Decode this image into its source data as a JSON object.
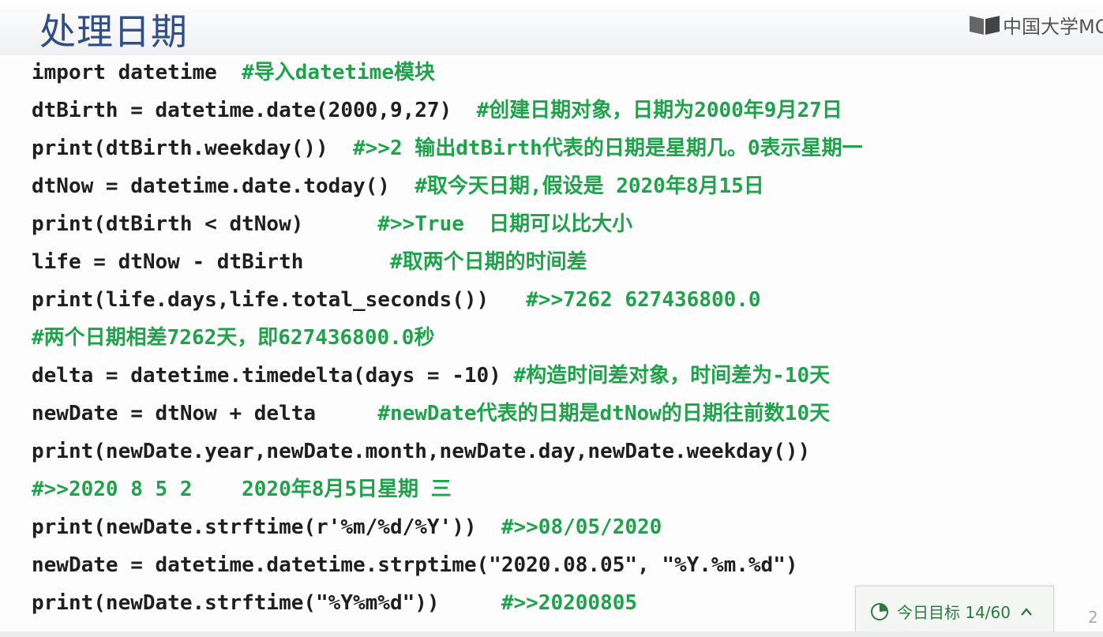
{
  "slide": {
    "title": "处理日期",
    "brand": "中国大学MO",
    "page_number": "2"
  },
  "code_lines": [
    {
      "code": "import datetime  ",
      "comment": "#导入datetime模块"
    },
    {
      "code": "dtBirth = datetime.date(2000,9,27)  ",
      "comment": "#创建日期对象，日期为2000年9月27日"
    },
    {
      "code": "print(dtBirth.weekday())  ",
      "comment": "#>>2 输出dtBirth代表的日期是星期几。0表示星期一"
    },
    {
      "code": "dtNow = datetime.date.today()  ",
      "comment": "#取今天日期,假设是 2020年8月15日"
    },
    {
      "code": "print(dtBirth < dtNow)      ",
      "comment": "#>>True  日期可以比大小"
    },
    {
      "code": "life = dtNow - dtBirth       ",
      "comment": "#取两个日期的时间差"
    },
    {
      "code": "print(life.days,life.total_seconds())   ",
      "comment": "#>>7262 627436800.0"
    },
    {
      "code": "",
      "comment": "#两个日期相差7262天，即627436800.0秒"
    },
    {
      "code": "delta = datetime.timedelta(days = -10) ",
      "comment": "#构造时间差对象，时间差为-10天"
    },
    {
      "code": "newDate = dtNow + delta     ",
      "comment": "#newDate代表的日期是dtNow的日期往前数10天"
    },
    {
      "code": "print(newDate.year,newDate.month,newDate.day,newDate.weekday())",
      "comment": ""
    },
    {
      "code": "",
      "comment": "#>>2020 8 5 2    2020年8月5日星期 三"
    },
    {
      "code": "print(newDate.strftime(r'%m/%d/%Y'))  ",
      "comment": "#>>08/05/2020"
    },
    {
      "code": "newDate = datetime.datetime.strptime(\"2020.08.05\", \"%Y.%m.%d\")",
      "comment": ""
    },
    {
      "code": "print(newDate.strftime(\"%Y%m%d\"))     ",
      "comment": "#>>20200805"
    }
  ],
  "daily_goal": {
    "label": "今日目标 14/60",
    "progress": 0.2333,
    "icon": "pie-progress-icon",
    "caret_icon": "chevron-up-icon"
  },
  "colors": {
    "title": "#2f4f86",
    "code": "#1f1f1f",
    "comment": "#1fa34a"
  }
}
